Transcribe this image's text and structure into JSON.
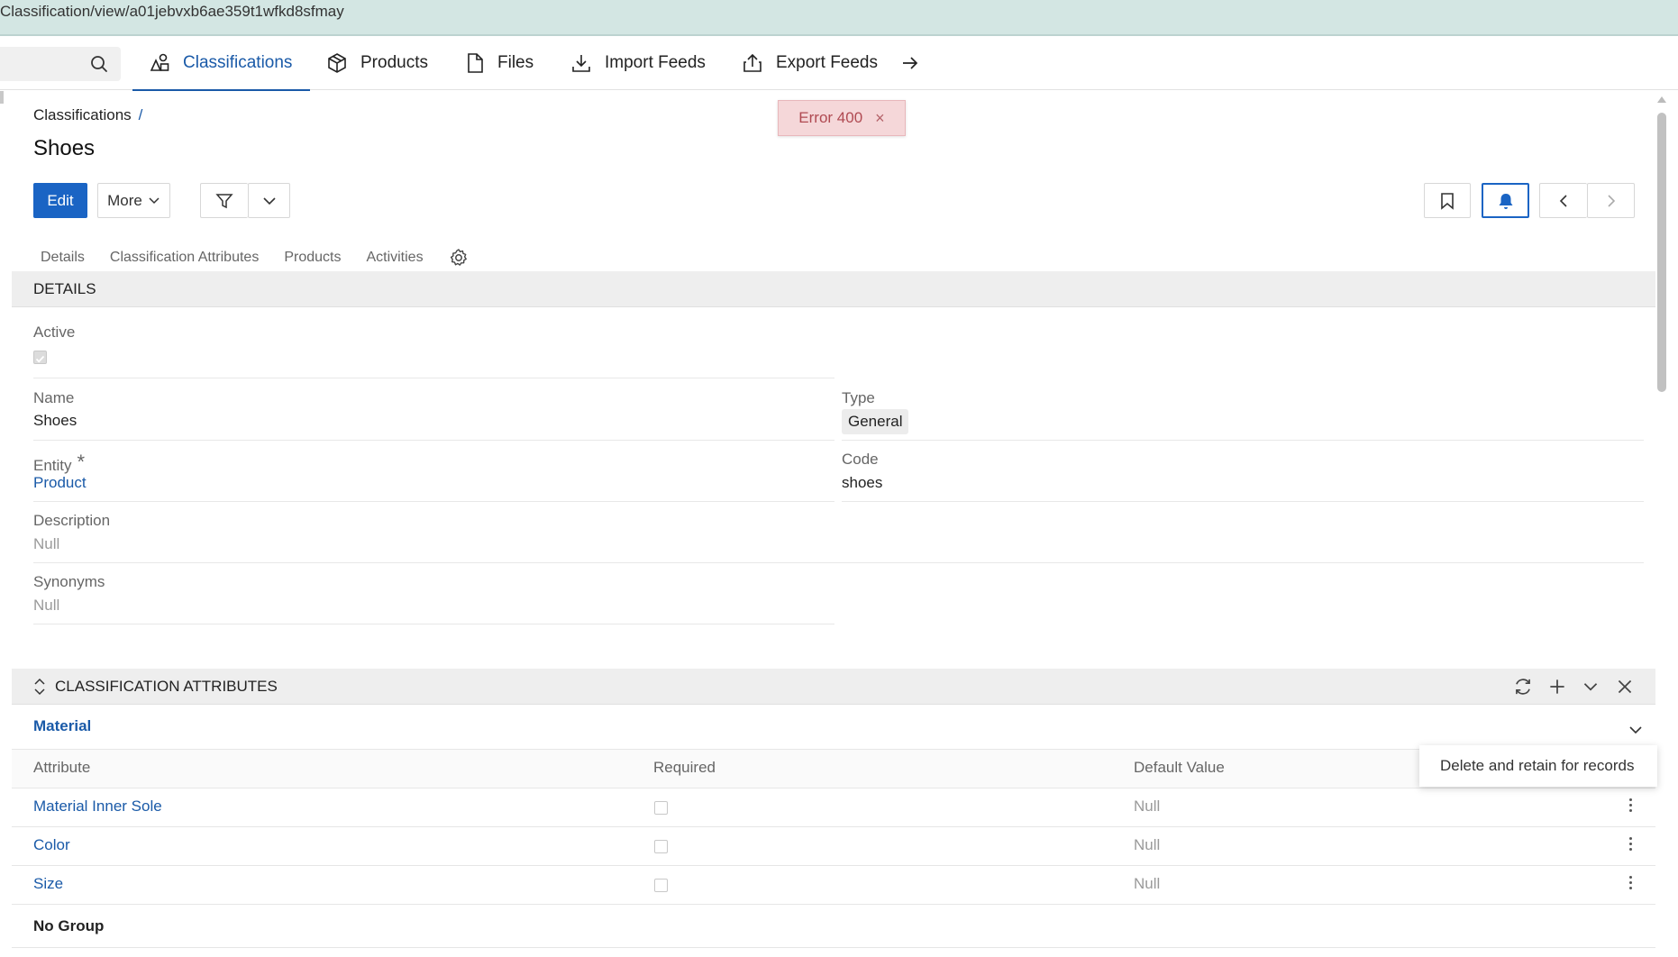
{
  "browser": {
    "url": "Classification/view/a01jebvxb6ae359t1wfkd8sfmay"
  },
  "topnav": {
    "items": [
      {
        "label": "Classifications",
        "icon": "classifications-icon",
        "active": true
      },
      {
        "label": "Products",
        "icon": "box-icon"
      },
      {
        "label": "Files",
        "icon": "file-icon"
      },
      {
        "label": "Import Feeds",
        "icon": "download-icon"
      },
      {
        "label": "Export Feeds",
        "icon": "upload-icon"
      }
    ],
    "more_icon": "arrow-right-icon"
  },
  "breadcrumb": {
    "parent": "Classifications",
    "separator": "/"
  },
  "title": "Shoes",
  "toast": {
    "text": "Error 400",
    "close": "×"
  },
  "toolbar": {
    "edit_label": "Edit",
    "more_label": "More"
  },
  "tabs": [
    "Details",
    "Classification Attributes",
    "Products",
    "Activities"
  ],
  "details": {
    "heading": "DETAILS",
    "active_label": "Active",
    "active_value": true,
    "name_label": "Name",
    "name_value": "Shoes",
    "type_label": "Type",
    "type_value": "General",
    "entity_label": "Entity",
    "entity_required_mark": "*",
    "entity_value": "Product",
    "code_label": "Code",
    "code_value": "shoes",
    "description_label": "Description",
    "description_value": "Null",
    "synonyms_label": "Synonyms",
    "synonyms_value": "Null"
  },
  "classification_attributes": {
    "heading": "CLASSIFICATION ATTRIBUTES",
    "group_name": "Material",
    "columns": [
      "Attribute",
      "Required",
      "Default Value"
    ],
    "rows": [
      {
        "attribute": "Material Inner Sole",
        "required": false,
        "default": "Null"
      },
      {
        "attribute": "Color",
        "required": false,
        "default": "Null"
      },
      {
        "attribute": "Size",
        "required": false,
        "default": "Null"
      }
    ],
    "no_group_label": "No Group",
    "context_menu_item": "Delete and retain for records"
  },
  "colors": {
    "accent": "#1a64c4",
    "link": "#1a5aa8",
    "toast_bg": "#f5d7d9",
    "toast_text": "#b04a52",
    "urlbar_bg": "#d3e6e3"
  }
}
